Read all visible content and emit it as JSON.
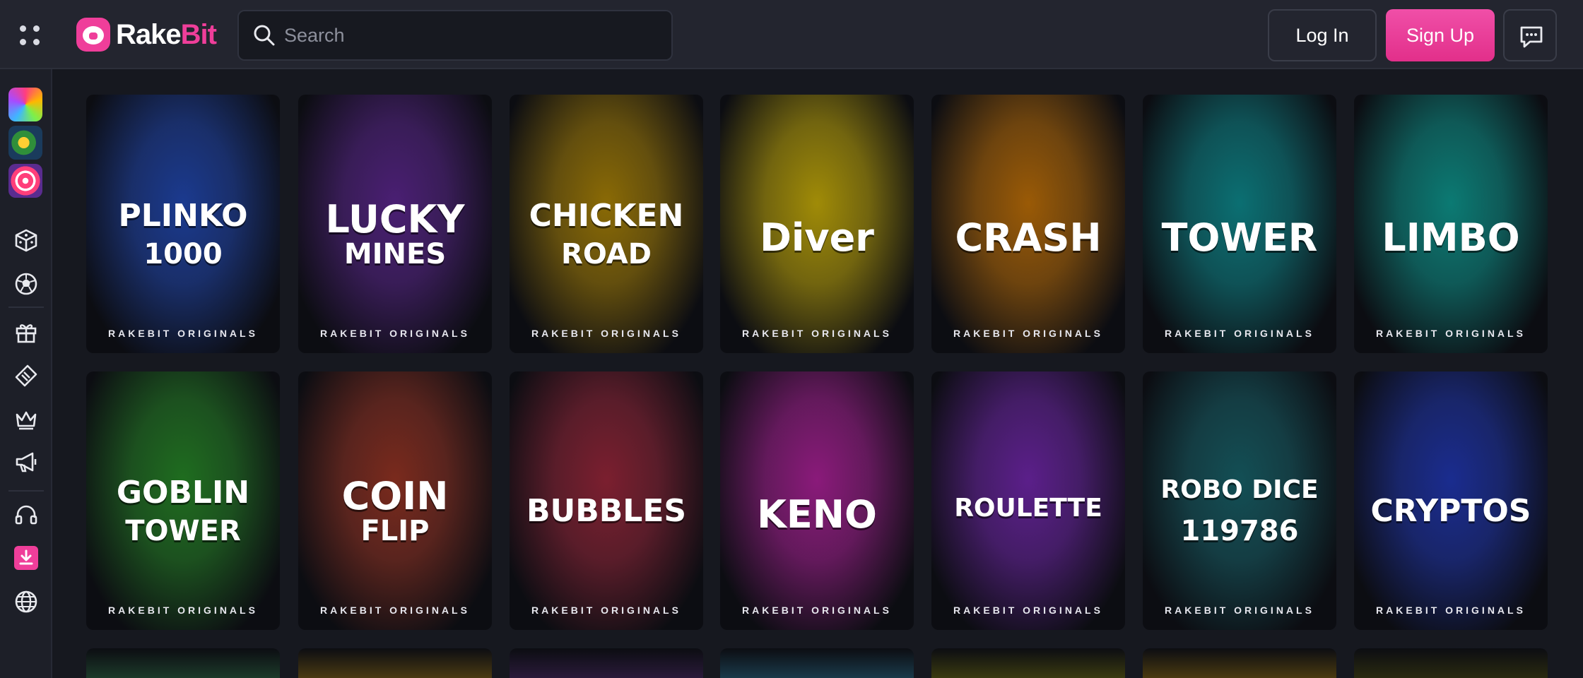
{
  "header": {
    "brand_part1": "Rake",
    "brand_part2": "Bit",
    "search_placeholder": "Search",
    "login_label": "Log In",
    "signup_label": "Sign Up",
    "accent_color": "#ef3e9a"
  },
  "sidebar": {
    "featured": [
      "featured-game-1",
      "featured-game-2",
      "featured-game-3"
    ],
    "icons": [
      "dice-icon",
      "soccer-ball-icon",
      "gift-icon",
      "ticket-icon",
      "crown-icon",
      "megaphone-icon",
      "headset-icon",
      "download-icon",
      "globe-icon"
    ]
  },
  "games": [
    {
      "title_line1": "PLINKO",
      "title_line2": "1000",
      "tag": "RAKEBIT ORIGINALS",
      "color": "#1b3a8f"
    },
    {
      "title_line1": "LUCKY",
      "title_line2": "MINES",
      "tag": "RAKEBIT ORIGINALS",
      "color": "#4a1f73"
    },
    {
      "title_line1": "CHICKEN",
      "title_line2": "ROAD",
      "tag": "RAKEBIT ORIGINALS",
      "color": "#8a6a05"
    },
    {
      "title_line1": "Diver",
      "title_line2": "",
      "tag": "RAKEBIT ORIGINALS",
      "color": "#a08b07"
    },
    {
      "title_line1": "CRASH",
      "title_line2": "",
      "tag": "RAKEBIT ORIGINALS",
      "color": "#9a5a06"
    },
    {
      "title_line1": "TOWER",
      "title_line2": "",
      "tag": "RAKEBIT ORIGINALS",
      "color": "#0b6f72"
    },
    {
      "title_line1": "LIMBO",
      "title_line2": "",
      "tag": "RAKEBIT ORIGINALS",
      "color": "#0b7a73"
    },
    {
      "title_line1": "GOBLIN",
      "title_line2": "TOWER",
      "tag": "RAKEBIT ORIGINALS",
      "color": "#1f6d1f"
    },
    {
      "title_line1": "COIN",
      "title_line2": "FLIP",
      "tag": "RAKEBIT ORIGINALS",
      "color": "#7a2a1d"
    },
    {
      "title_line1": "BUBBLES",
      "title_line2": "",
      "tag": "RAKEBIT ORIGINALS",
      "color": "#7b1f2f"
    },
    {
      "title_line1": "KENO",
      "title_line2": "",
      "tag": "RAKEBIT ORIGINALS",
      "color": "#8a1a7a"
    },
    {
      "title_line1": "ROULETTE",
      "title_line2": "",
      "tag": "RAKEBIT ORIGINALS",
      "color": "#5b1f8a"
    },
    {
      "title_line1": "ROBO DICE",
      "title_line2": "119786",
      "tag": "RAKEBIT ORIGINALS",
      "color": "#134f55"
    },
    {
      "title_line1": "CRYPTOS",
      "title_line2": "",
      "tag": "RAKEBIT ORIGINALS",
      "color": "#1a2c8f"
    }
  ]
}
